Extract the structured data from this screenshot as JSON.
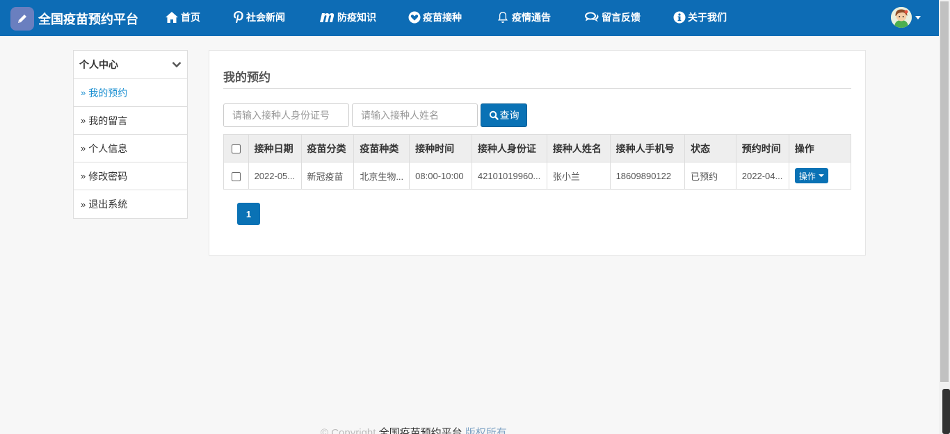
{
  "navbar": {
    "brand_title": "全国疫苗预约平台",
    "items": [
      {
        "label": "首页",
        "icon": "home-icon"
      },
      {
        "label": "社会新闻",
        "icon": "pinterest-icon"
      },
      {
        "label": "防疫知识",
        "icon": "m-icon"
      },
      {
        "label": "疫苗接种",
        "icon": "heart-circle-icon"
      },
      {
        "label": "疫情通告",
        "icon": "bell-icon"
      },
      {
        "label": "留言反馈",
        "icon": "comments-icon"
      },
      {
        "label": "关于我们",
        "icon": "info-icon"
      }
    ],
    "accent_color": "#0d6cb5"
  },
  "sidebar": {
    "header": "个人中心",
    "items": [
      {
        "label": "我的预约",
        "active": true
      },
      {
        "label": "我的留言"
      },
      {
        "label": "个人信息"
      },
      {
        "label": "修改密码"
      },
      {
        "label": "退出系统"
      }
    ]
  },
  "main": {
    "title": "我的预约",
    "search": {
      "id_placeholder": "请输入接种人身份证号",
      "name_placeholder": "请输入接种人姓名",
      "button_label": "查询"
    },
    "table": {
      "columns": [
        "接种日期",
        "疫苗分类",
        "疫苗种类",
        "接种时间",
        "接种人身份证",
        "接种人姓名",
        "接种人手机号",
        "状态",
        "预约时间",
        "操作"
      ],
      "rows": [
        {
          "date": "2022-05...",
          "category": "新冠疫苗",
          "type": "北京生物...",
          "time": "08:00-10:00",
          "id_card": "42101019960...",
          "name": "张小兰",
          "phone": "18609890122",
          "status": "已预约",
          "booked_at": "2022-04...",
          "action_label": "操作"
        }
      ]
    },
    "pagination": {
      "current": "1"
    }
  },
  "footer": {
    "copyright": "© Copyright ",
    "site": "全国疫苗预约平台",
    "rights": " 版权所有"
  }
}
